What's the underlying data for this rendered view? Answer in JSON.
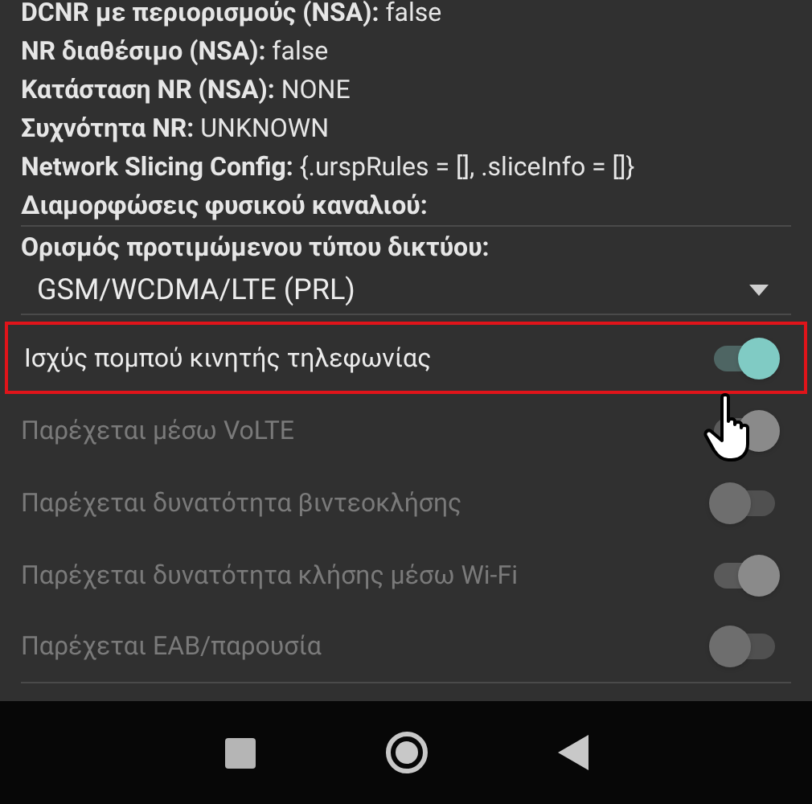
{
  "info_lines": [
    "**DCNR με περιορισμούς (NSA):** false",
    "**NR διαθέσιμο (NSA):** false",
    "**Κατάσταση NR (NSA):** NONE",
    "**Συχνότητα NR:** UNKNOWN",
    "**Network Slicing Config:** {.urspRules = [], .sliceInfo = []}",
    "**Διαμορφώσεις φυσικού καναλιού:**"
  ],
  "network_type": {
    "label": "Ορισμός προτιμώμενου τύπου δικτύου:",
    "value": "GSM/WCDMA/LTE (PRL)"
  },
  "switches": [
    {
      "label": "Ισχύς πομπού κινητής τηλεφωνίας",
      "on": true,
      "disabled": false,
      "highlighted": true
    },
    {
      "label": "Παρέχεται μέσω VoLTE",
      "on": true,
      "disabled": true,
      "highlighted": false
    },
    {
      "label": "Παρέχεται δυνατότητα βιντεοκλήσης",
      "on": false,
      "disabled": true,
      "highlighted": false
    },
    {
      "label": "Παρέχεται δυνατότητα κλήσης μέσω Wi-Fi",
      "on": true,
      "disabled": true,
      "highlighted": false
    },
    {
      "label": "Παρέχεται EAB/παρουσία",
      "on": false,
      "disabled": true,
      "highlighted": false
    }
  ]
}
